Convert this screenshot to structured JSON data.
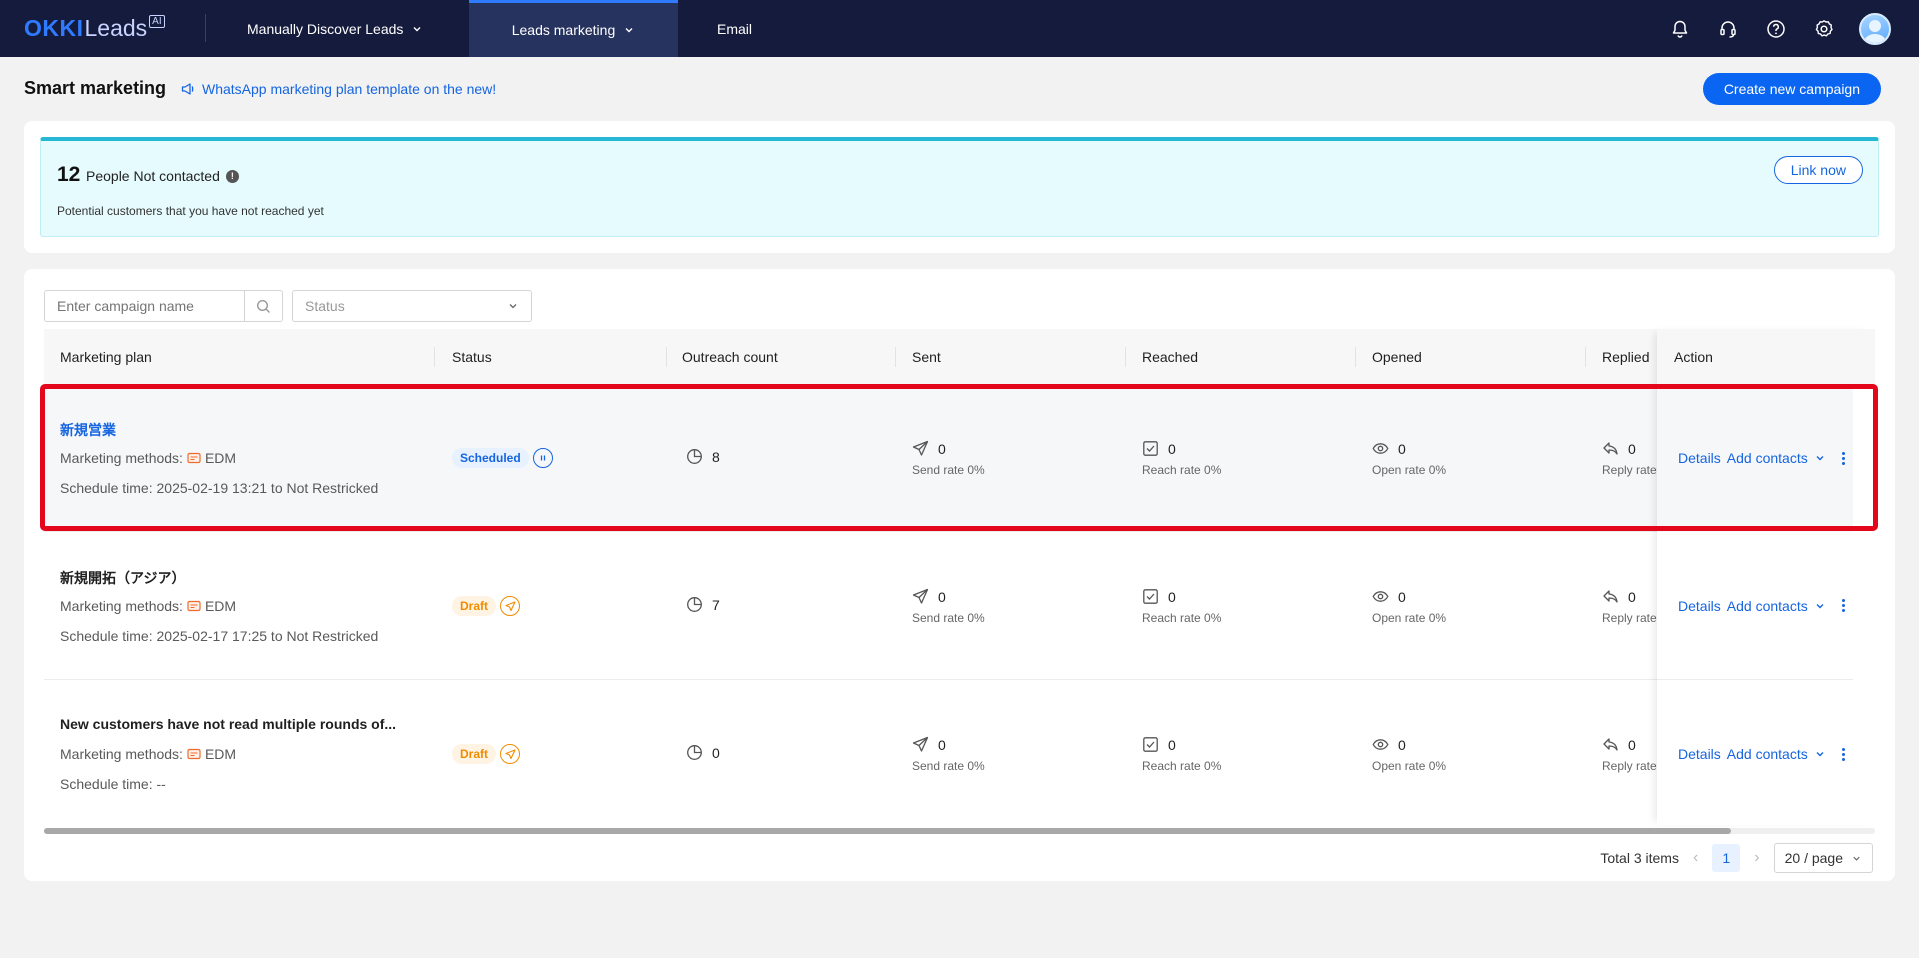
{
  "topbar": {
    "logo_main": "OKKI",
    "logo_sub": "Leads",
    "logo_badge": "AI",
    "nav": [
      {
        "label": "Manually Discover Leads"
      },
      {
        "label": "Leads marketing"
      },
      {
        "label": "Email"
      }
    ],
    "icons": [
      "bell-icon",
      "headset-icon",
      "help-icon",
      "gear-icon",
      "avatar"
    ]
  },
  "header": {
    "title": "Smart marketing",
    "promo_text": "WhatsApp marketing plan template on the new!",
    "create_button": "Create new campaign"
  },
  "not_contacted": {
    "count": "12",
    "title": "People Not contacted",
    "subtitle": "Potential customers that you have not reached yet",
    "link_button": "Link now"
  },
  "filters": {
    "search_placeholder": "Enter campaign name",
    "status_placeholder": "Status"
  },
  "table": {
    "columns": [
      "Marketing plan",
      "Status",
      "Outreach count",
      "Sent",
      "Reached",
      "Opened",
      "Replied",
      "Action"
    ],
    "rows": [
      {
        "name": "新規営業",
        "method_label": "Marketing methods:",
        "method": "EDM",
        "schedule": "Schedule time: 2025-02-19 13:21 to Not Restricked",
        "status": "Scheduled",
        "outreach": "8",
        "sent": "0",
        "sent_rate": "Send rate 0%",
        "reached": "0",
        "reach_rate": "Reach rate 0%",
        "opened": "0",
        "open_rate": "Open rate 0%",
        "replied": "0",
        "reply_rate": "Reply rate"
      },
      {
        "name": "新規開拓（アジア）",
        "method_label": "Marketing methods:",
        "method": "EDM",
        "schedule": "Schedule time: 2025-02-17 17:25 to Not Restricked",
        "status": "Draft",
        "outreach": "7",
        "sent": "0",
        "sent_rate": "Send rate 0%",
        "reached": "0",
        "reach_rate": "Reach rate 0%",
        "opened": "0",
        "open_rate": "Open rate 0%",
        "replied": "0",
        "reply_rate": "Reply rate"
      },
      {
        "name": "New customers have not read multiple rounds of...",
        "method_label": "Marketing methods:",
        "method": "EDM",
        "schedule": "Schedule time: --",
        "status": "Draft",
        "outreach": "0",
        "sent": "0",
        "sent_rate": "Send rate 0%",
        "reached": "0",
        "reach_rate": "Reach rate 0%",
        "opened": "0",
        "open_rate": "Open rate 0%",
        "replied": "0",
        "reply_rate": "Reply rate"
      }
    ],
    "action_details": "Details",
    "action_add": "Add contacts"
  },
  "pagination": {
    "total": "Total 3 items",
    "current_page": "1",
    "page_size": "20 / page"
  },
  "colors": {
    "nav_bg": "#151b3d",
    "accent": "#0a66f2",
    "highlight_border": "#e4071b",
    "draft": "#f08c00"
  }
}
